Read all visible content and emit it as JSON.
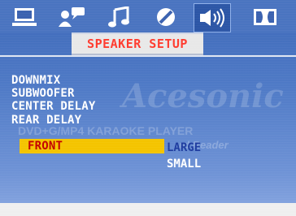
{
  "colors": {
    "screen_bg": "#4f7ac6",
    "title_text": "#ff3b2e",
    "highlight_bg": "#f4c400",
    "highlight_text": "#c40000",
    "menu_text": "#ffffff",
    "selected_option_text": "#1f3da0"
  },
  "tabs": [
    {
      "name": "monitor-icon"
    },
    {
      "name": "language-icon"
    },
    {
      "name": "audio-note-icon"
    },
    {
      "name": "video-adjust-icon"
    },
    {
      "name": "speaker-icon",
      "active": true
    },
    {
      "name": "dolby-icon"
    }
  ],
  "header": {
    "title": "SPEAKER SETUP"
  },
  "menu": {
    "items": [
      {
        "label": "DOWNMIX"
      },
      {
        "label": "SUBWOOFER"
      },
      {
        "label": "CENTER DELAY"
      },
      {
        "label": "REAR DELAY"
      },
      {
        "label": "FRONT",
        "selected": true
      }
    ]
  },
  "options": {
    "large": "LARGE",
    "small": "SMALL",
    "selected": "LARGE"
  },
  "watermark": {
    "brand": "Acesonic",
    "line1": "DVD+G/MP4 KARAOKE PLAYER",
    "line2": "rd Reader"
  }
}
